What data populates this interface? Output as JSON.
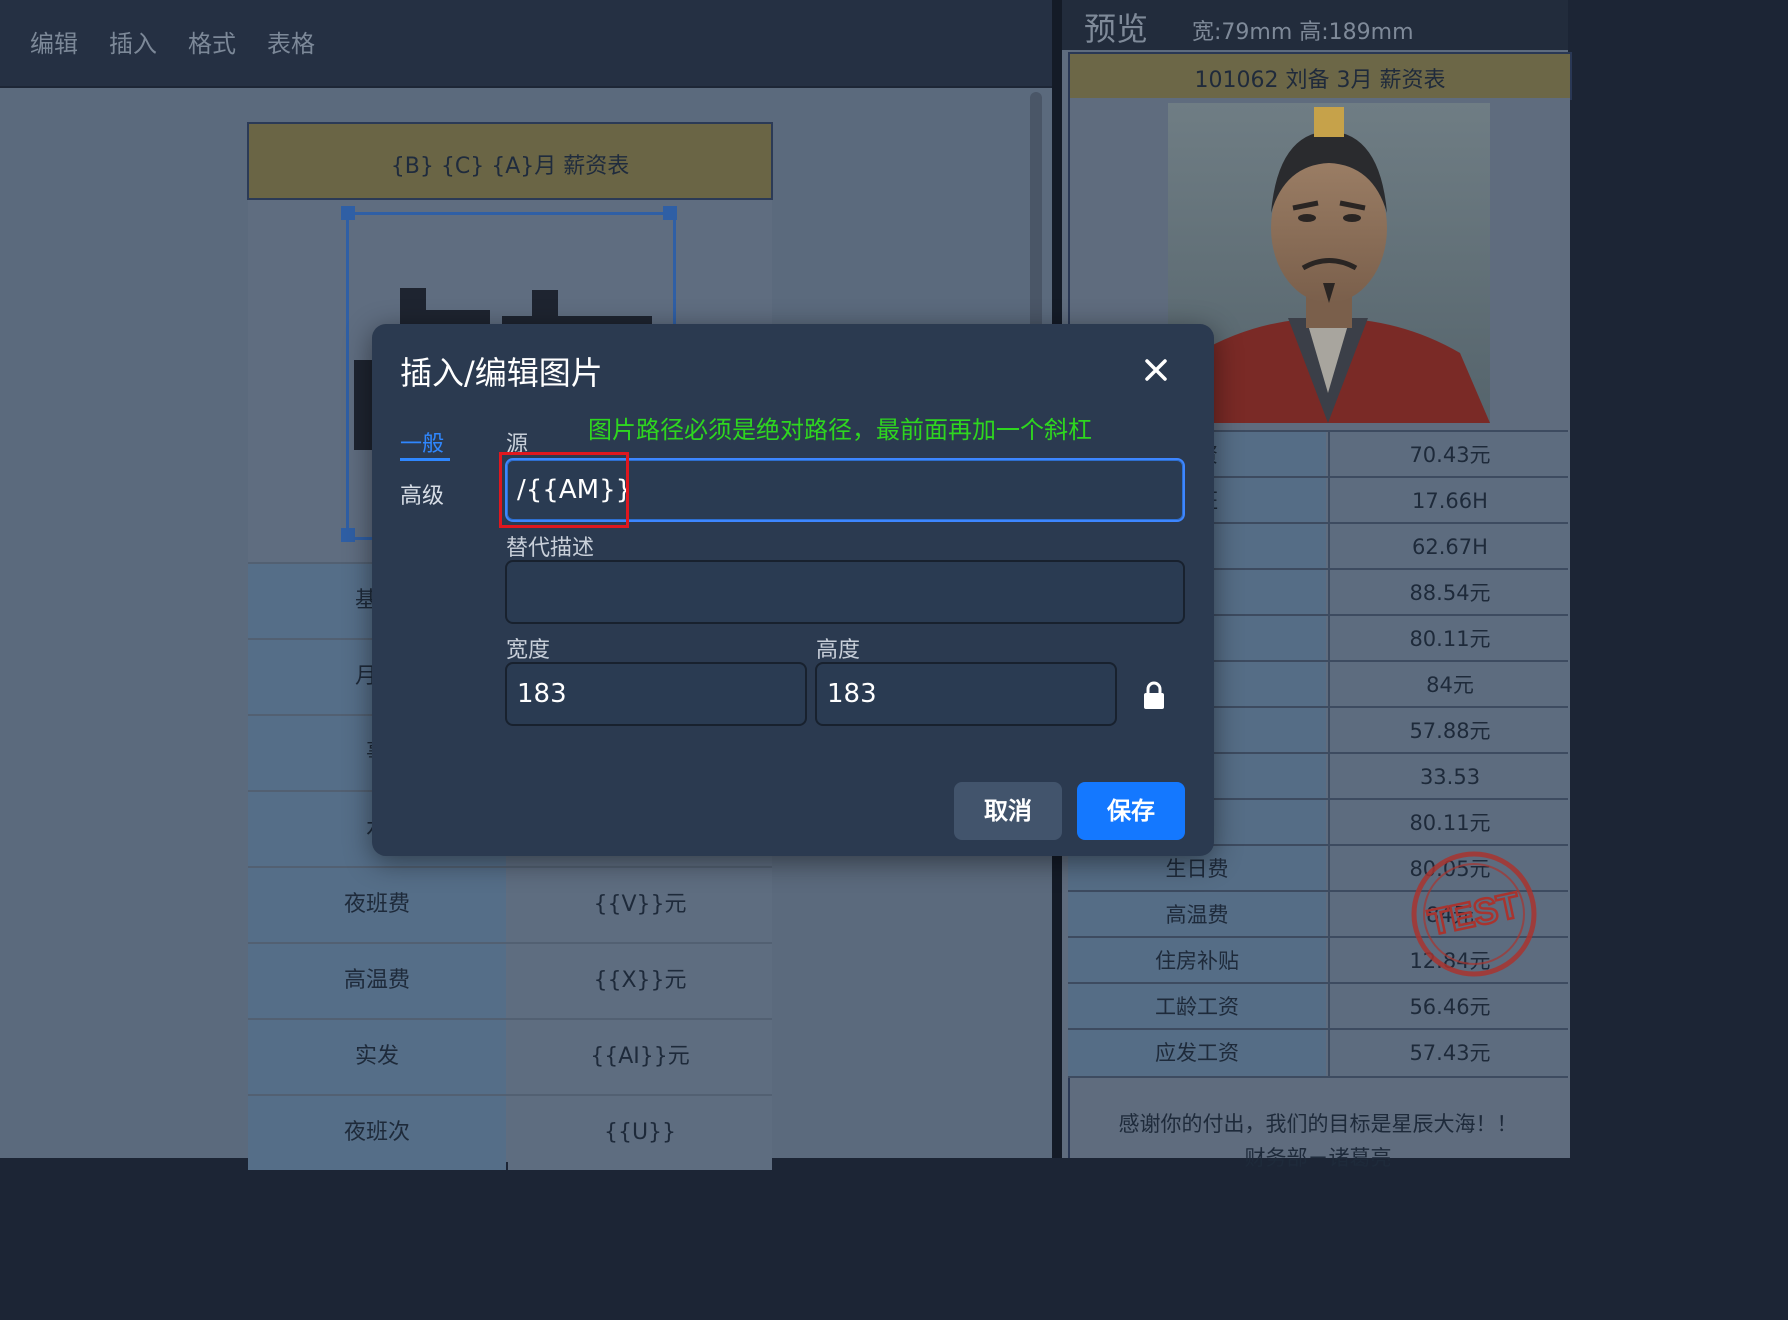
{
  "menu": {
    "items": [
      "编辑",
      "插入",
      "格式",
      "表格"
    ]
  },
  "document": {
    "title": "{B}  {C}  {A}月  薪资表",
    "rows": [
      {
        "label": "基本",
        "value": ""
      },
      {
        "label": "月累",
        "value": ""
      },
      {
        "label": "事",
        "value": ""
      },
      {
        "label": "水",
        "value": ""
      },
      {
        "label": "夜班费",
        "value": "{{V}}元"
      },
      {
        "label": "高温费",
        "value": "{{X}}元"
      },
      {
        "label": "实发",
        "value": "{{AI}}元"
      },
      {
        "label": "夜班次",
        "value": "{{U}}"
      }
    ]
  },
  "preview": {
    "title": "预览",
    "size_text": "宽:79mm 高:189mm",
    "band": "101062   刘备   3月   薪资表",
    "rows": [
      {
        "label": "工资",
        "value": "70.43元"
      },
      {
        "label": "上班",
        "value": "17.66H"
      },
      {
        "label": "加",
        "value": "62.67H"
      },
      {
        "label": "费",
        "value": "88.54元"
      },
      {
        "label": "费",
        "value": "80.11元"
      },
      {
        "label": "费",
        "value": "84元"
      },
      {
        "label": "发",
        "value": "57.88元"
      },
      {
        "label": "次",
        "value": "33.53"
      },
      {
        "label": "费",
        "value": "80.11元"
      },
      {
        "label": "生日费",
        "value": "80.05元"
      },
      {
        "label": "高温费",
        "value": "84元"
      },
      {
        "label": "住房补贴",
        "value": "12.84元"
      },
      {
        "label": "工龄工资",
        "value": "56.46元"
      },
      {
        "label": "应发工资",
        "value": "57.43元"
      }
    ],
    "stamp_text": "TEST",
    "footer_line1": "感谢你的付出，我们的目标是星辰大海！！",
    "footer_line2": "财务部－诸葛亮"
  },
  "modal": {
    "title": "插入/编辑图片",
    "close_icon": "close-icon",
    "tabs": {
      "general": "一般",
      "advanced": "高级"
    },
    "source_label": "源",
    "source_value": "/{{AM}}",
    "hint": "图片路径必须是绝对路径，最前面再加一个斜杠",
    "alt_label": "替代描述",
    "alt_value": "",
    "width_label": "宽度",
    "width_value": "183",
    "height_label": "高度",
    "height_value": "183",
    "lock_icon": "lock-icon",
    "cancel_label": "取消",
    "save_label": "保存"
  },
  "colors": {
    "accent": "#1478ff",
    "hint": "#2ed61f",
    "highlight_box": "#e0171f",
    "title_band": "#6a6545"
  }
}
